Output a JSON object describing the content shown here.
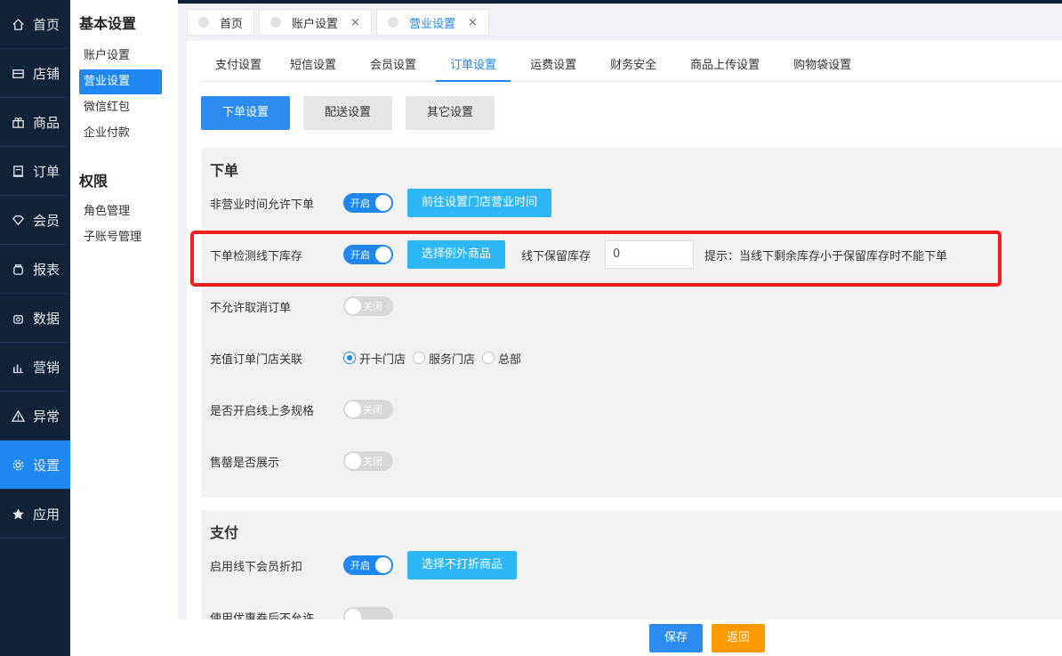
{
  "nav": {
    "items": [
      {
        "label": "首页",
        "icon": "home-icon"
      },
      {
        "label": "店铺",
        "icon": "store-icon"
      },
      {
        "label": "商品",
        "icon": "gift-icon"
      },
      {
        "label": "订单",
        "icon": "order-icon"
      },
      {
        "label": "会员",
        "icon": "diamond-icon"
      },
      {
        "label": "报表",
        "icon": "report-icon"
      },
      {
        "label": "数据",
        "icon": "data-icon"
      },
      {
        "label": "营销",
        "icon": "chart-icon"
      },
      {
        "label": "异常",
        "icon": "warning-icon"
      },
      {
        "label": "设置",
        "icon": "gear-icon"
      },
      {
        "label": "应用",
        "icon": "star-icon"
      }
    ],
    "active": "设置"
  },
  "sidebar": {
    "basic_title": "基本设置",
    "basic_items": [
      "账户设置",
      "营业设置",
      "微信红包",
      "企业付款"
    ],
    "perm_title": "权限",
    "perm_items": [
      "角色管理",
      "子账号管理"
    ]
  },
  "pagetabs": [
    {
      "label": "首页"
    },
    {
      "label": "账户设置",
      "close": "×"
    },
    {
      "label": "营业设置",
      "close": "×"
    }
  ],
  "subtabs": [
    "支付设置",
    "短信设置",
    "会员设置",
    "订单设置",
    "运费设置",
    "财务安全",
    "商品上传设置",
    "购物袋设置"
  ],
  "segments": [
    "下单设置",
    "配送设置",
    "其它设置"
  ],
  "order_section": {
    "title": "下单",
    "r1_label": "非营业时间允许下单",
    "r1_toggle": "开启",
    "r1_button": "前往设置门店营业时间",
    "r2_label": "下单检测线下库存",
    "r2_toggle": "开启",
    "r2_button": "选择例外商品",
    "r2_stock_label": "线下保留库存",
    "r2_stock_value": "0",
    "r2_tip": "提示：当线下剩余库存小于保留库存时不能下单",
    "r3_label": "不允许取消订单",
    "r3_toggle": "关闭",
    "r4_label": "充值订单门店关联",
    "r4_options": [
      "开卡门店",
      "服务门店",
      "总部"
    ],
    "r5_label": "是否开启线上多规格",
    "r5_toggle": "关闭",
    "r6_label": "售罄是否展示",
    "r6_toggle": "关闭"
  },
  "pay_section": {
    "title": "支付",
    "r1_label": "启用线下会员折扣",
    "r1_toggle": "开启",
    "r1_button": "选择不打折商品",
    "r2_label": "使用优惠券后不允许"
  },
  "footer": {
    "save": "保存",
    "back": "返回"
  },
  "colors": {
    "nav_bg": "#0f2238",
    "accent": "#1e88f0",
    "info_button": "#2db7f5",
    "back_button": "#ff9900",
    "highlight": "#f02020"
  }
}
